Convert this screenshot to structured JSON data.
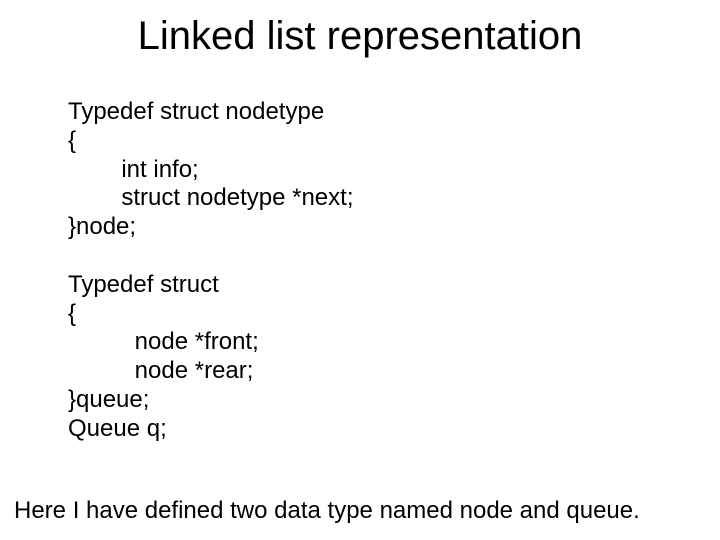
{
  "title": "Linked list representation",
  "code": {
    "l1": "Typedef struct nodetype",
    "l2": "{",
    "l3": "        int info;",
    "l4": "        struct nodetype *next;",
    "l5": "}node;",
    "blank1": " ",
    "l6": "Typedef struct",
    "l7": "{",
    "l8": "          node *front;",
    "l9": "          node *rear;",
    "l10": "}queue;",
    "l11": "Queue q;"
  },
  "footer": "Here I have defined two data type named node and queue."
}
